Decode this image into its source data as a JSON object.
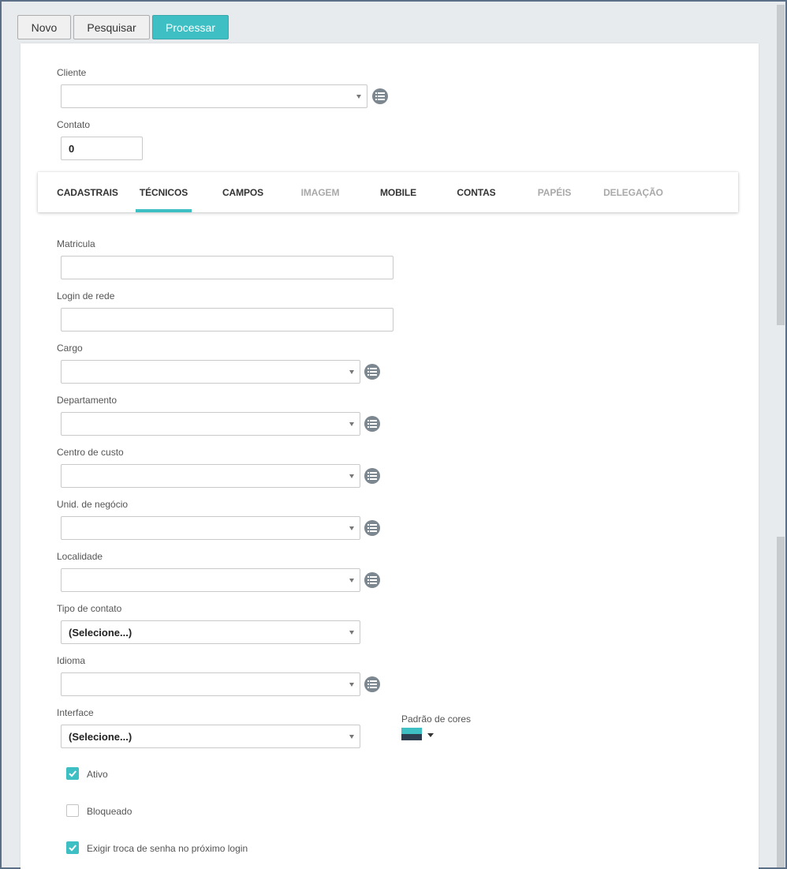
{
  "toolbar": {
    "novo": "Novo",
    "pesquisar": "Pesquisar",
    "processar": "Processar"
  },
  "cliente": {
    "label": "Cliente",
    "value": ""
  },
  "contato": {
    "label": "Contato",
    "value": "0"
  },
  "tabs": [
    {
      "label": "CADASTRAIS",
      "disabled": false
    },
    {
      "label": "TÉCNICOS",
      "active": true
    },
    {
      "label": "CAMPOS",
      "disabled": false
    },
    {
      "label": "IMAGEM",
      "disabled": true
    },
    {
      "label": "MOBILE",
      "disabled": false
    },
    {
      "label": "CONTAS",
      "disabled": false
    },
    {
      "label": "PAPÉIS",
      "disabled": true
    },
    {
      "label": "DELEGAÇÃO",
      "disabled": true
    }
  ],
  "fields": {
    "matricula": {
      "label": "Matricula",
      "value": ""
    },
    "login_rede": {
      "label": "Login de rede",
      "value": ""
    },
    "cargo": {
      "label": "Cargo",
      "value": ""
    },
    "departamento": {
      "label": "Departamento",
      "value": ""
    },
    "centro_custo": {
      "label": "Centro de custo",
      "value": ""
    },
    "unid_negocio": {
      "label": "Unid. de negócio",
      "value": ""
    },
    "localidade": {
      "label": "Localidade",
      "value": ""
    },
    "tipo_contato": {
      "label": "Tipo de contato",
      "value": "(Selecione...)"
    },
    "idioma": {
      "label": "Idioma",
      "value": ""
    },
    "interface": {
      "label": "Interface",
      "value": "(Selecione...)"
    }
  },
  "padrao_cores": {
    "label": "Padrão de cores",
    "top_color": "#3dbfc4",
    "bottom_color": "#2c3e50"
  },
  "checks": {
    "ativo": {
      "label": "Ativo",
      "checked": true
    },
    "bloqueado": {
      "label": "Bloqueado",
      "checked": false
    },
    "exigir": {
      "label": "Exigir troca de senha no próximo login",
      "checked": true
    }
  },
  "colors": {
    "accent": "#3dbfc4",
    "icon_gray": "#7c8790"
  },
  "icons": {
    "list": "list-icon",
    "check": "check-icon",
    "caret": "chevron-down-icon"
  }
}
